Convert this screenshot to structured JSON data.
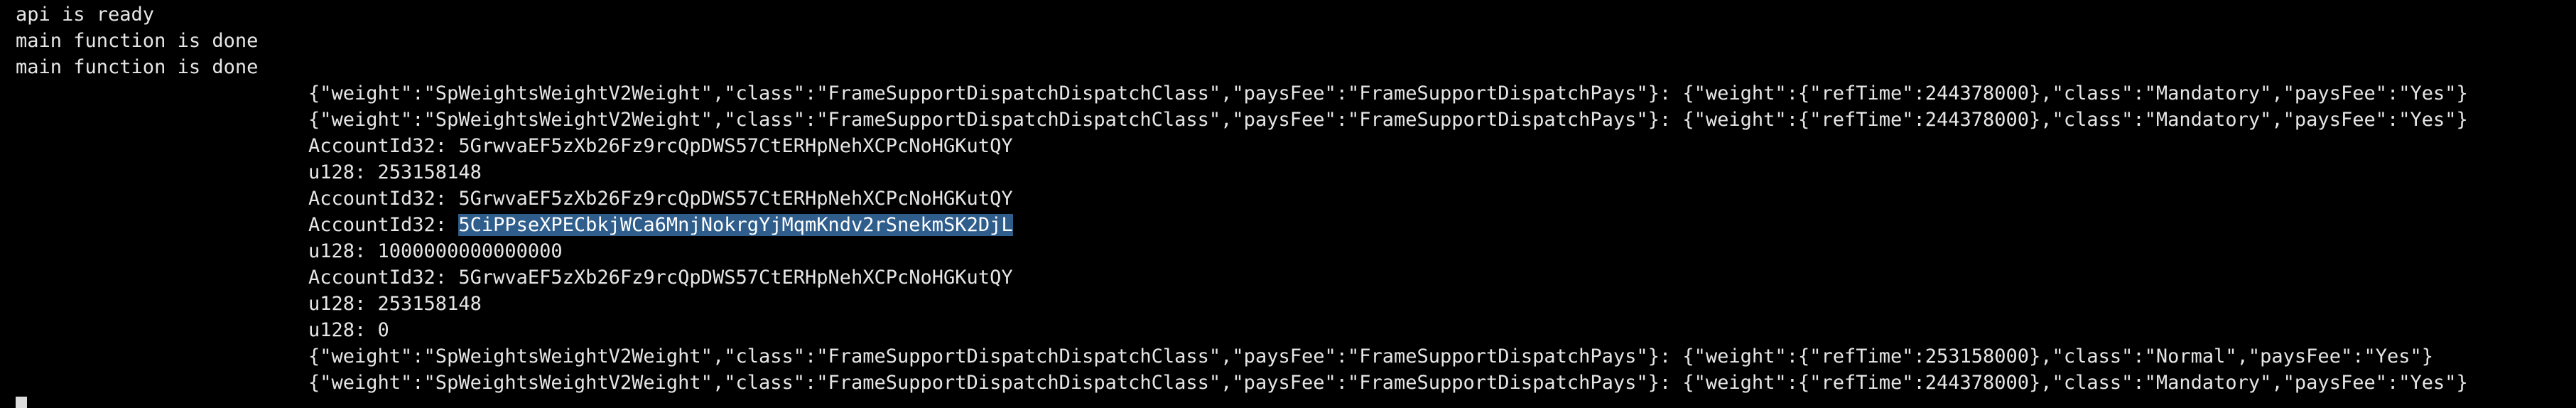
{
  "terminal": {
    "lines": [
      "api is ready",
      "main function is done",
      "main function is done",
      "{\"weight\":\"SpWeightsWeightV2Weight\",\"class\":\"FrameSupportDispatchDispatchClass\",\"paysFee\":\"FrameSupportDispatchPays\"}: {\"weight\":{\"refTime\":244378000},\"class\":\"Mandatory\",\"paysFee\":\"Yes\"}",
      "{\"weight\":\"SpWeightsWeightV2Weight\",\"class\":\"FrameSupportDispatchDispatchClass\",\"paysFee\":\"FrameSupportDispatchPays\"}: {\"weight\":{\"refTime\":244378000},\"class\":\"Mandatory\",\"paysFee\":\"Yes\"}",
      "AccountId32: 5GrwvaEF5zXb26Fz9rcQpDWS57CtERHpNehXCPcNoHGKutQY",
      "u128: 253158148",
      "AccountId32: 5GrwvaEF5zXb26Fz9rcQpDWS57CtERHpNehXCPcNoHGKutQY",
      "AccountId32: ",
      "u128: 1000000000000000",
      "AccountId32: 5GrwvaEF5zXb26Fz9rcQpDWS57CtERHpNehXCPcNoHGKutQY",
      "u128: 253158148",
      "u128: 0",
      "{\"weight\":\"SpWeightsWeightV2Weight\",\"class\":\"FrameSupportDispatchDispatchClass\",\"paysFee\":\"FrameSupportDispatchPays\"}: {\"weight\":{\"refTime\":253158000},\"class\":\"Normal\",\"paysFee\":\"Yes\"}",
      "{\"weight\":\"SpWeightsWeightV2Weight\",\"class\":\"FrameSupportDispatchDispatchClass\",\"paysFee\":\"FrameSupportDispatchPays\"}: {\"weight\":{\"refTime\":244378000},\"class\":\"Mandatory\",\"paysFee\":\"Yes\"}"
    ],
    "selected_text": "5CiPPseXPECbkjWCa6MnjNokrgYjMqmKndv2rSnekmSK2DjL"
  },
  "colors": {
    "background": "#000000",
    "foreground": "#e6e6e6",
    "selection": "#2f5d8c"
  }
}
